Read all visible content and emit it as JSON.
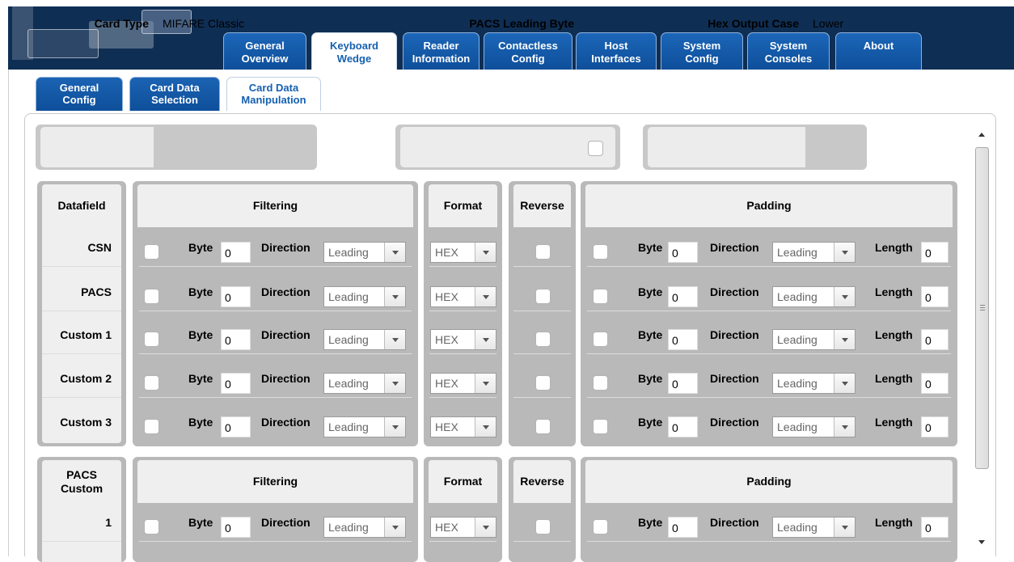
{
  "main_tabs": [
    {
      "label": "General\nOverview",
      "active": false
    },
    {
      "label": "Keyboard\nWedge",
      "active": true
    },
    {
      "label": "Reader\nInformation",
      "active": false
    },
    {
      "label": "Contactless\nConfig",
      "active": false
    },
    {
      "label": "Host\nInterfaces",
      "active": false
    },
    {
      "label": "System\nConfig",
      "active": false
    },
    {
      "label": "System\nConsoles",
      "active": false
    },
    {
      "label": "About",
      "active": false
    }
  ],
  "sub_tabs": [
    {
      "label": "General\nConfig",
      "active": false
    },
    {
      "label": "Card Data\nSelection",
      "active": false
    },
    {
      "label": "Card Data\nManipulation",
      "active": true
    }
  ],
  "card_type": {
    "label": "Card Type",
    "value": "MIFARE Classic"
  },
  "pacs_leading_byte": {
    "label": "PACS Leading Byte",
    "checked": false
  },
  "hex_output_case": {
    "label": "Hex Output Case",
    "value": "Lower"
  },
  "table1": {
    "headers": {
      "datafield": "Datafield",
      "filtering": "Filtering",
      "format": "Format",
      "reverse": "Reverse",
      "padding": "Padding"
    },
    "rows": [
      {
        "name": "CSN",
        "filter_byte": "0",
        "filter_direction": "Leading",
        "format": "HEX",
        "pad_byte": "0",
        "pad_direction": "Leading",
        "pad_length": "0"
      },
      {
        "name": "PACS",
        "filter_byte": "0",
        "filter_direction": "Leading",
        "format": "HEX",
        "pad_byte": "0",
        "pad_direction": "Leading",
        "pad_length": "0"
      },
      {
        "name": "Custom 1",
        "filter_byte": "0",
        "filter_direction": "Leading",
        "format": "HEX",
        "pad_byte": "0",
        "pad_direction": "Leading",
        "pad_length": "0"
      },
      {
        "name": "Custom 2",
        "filter_byte": "0",
        "filter_direction": "Leading",
        "format": "HEX",
        "pad_byte": "0",
        "pad_direction": "Leading",
        "pad_length": "0"
      },
      {
        "name": "Custom 3",
        "filter_byte": "0",
        "filter_direction": "Leading",
        "format": "HEX",
        "pad_byte": "0",
        "pad_direction": "Leading",
        "pad_length": "0"
      }
    ]
  },
  "table2": {
    "headers": {
      "datafield": "PACS\nCustom",
      "filtering": "Filtering",
      "format": "Format",
      "reverse": "Reverse",
      "padding": "Padding"
    },
    "rows": [
      {
        "name": "1",
        "filter_byte": "0",
        "filter_direction": "Leading",
        "format": "HEX",
        "pad_byte": "0",
        "pad_direction": "Leading",
        "pad_length": "0"
      }
    ]
  },
  "field_labels": {
    "byte": "Byte",
    "direction": "Direction",
    "length": "Length"
  }
}
